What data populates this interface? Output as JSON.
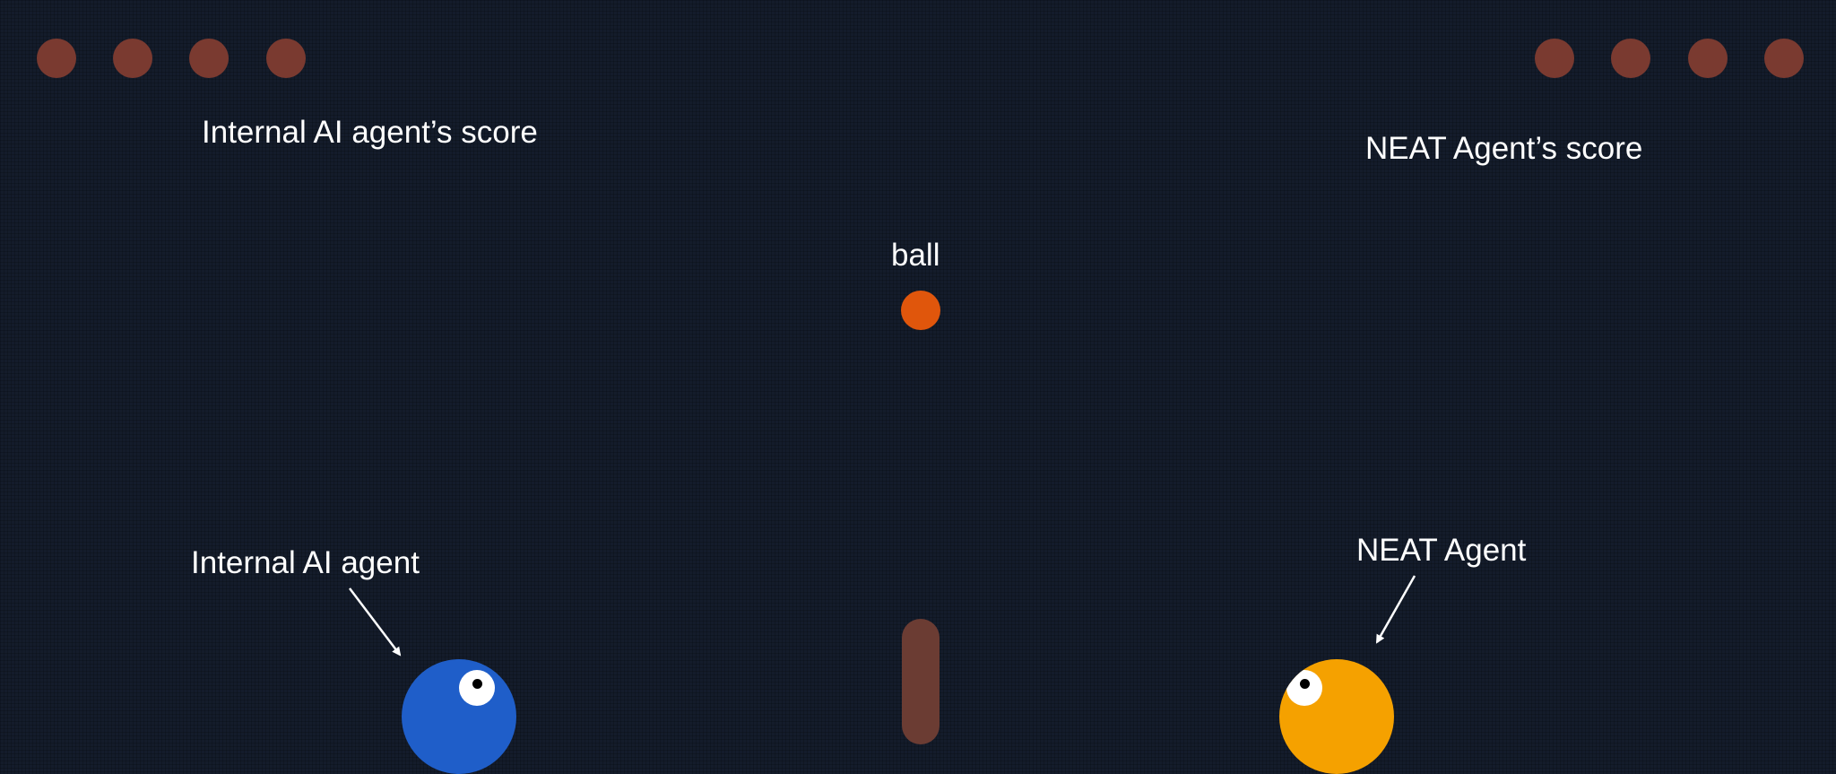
{
  "labels": {
    "left_score": "Internal AI agent’s score",
    "right_score": "NEAT Agent’s score",
    "ball": "ball",
    "left_agent": "Internal AI agent",
    "right_agent": "NEAT Agent"
  },
  "scoreboard": {
    "left_lives": 4,
    "right_lives": 4
  },
  "colors": {
    "background": "#141c2b",
    "life_dot": "#7a3a30",
    "ball": "#e0560c",
    "net": "#6b3c33",
    "left_agent": "#1f5ec9",
    "right_agent": "#f5a100",
    "arrow": "#ffffff"
  },
  "icons": {
    "life": "circle-dot",
    "ball": "circle",
    "agent_eye": "eye"
  }
}
